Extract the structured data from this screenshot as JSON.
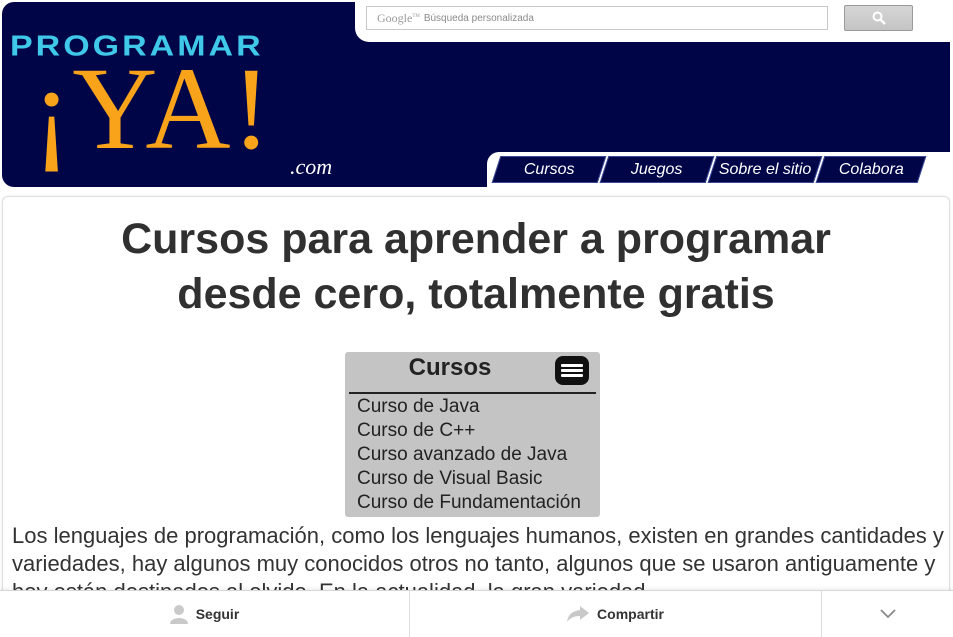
{
  "search": {
    "brand": "Google",
    "brand_tm": "TM",
    "placeholder": "Búsqueda personalizada",
    "button_icon": "search-icon"
  },
  "logo": {
    "top_text": "PROGRAMAR",
    "main_text": "¡YA!",
    "suffix": ".com"
  },
  "nav": {
    "items": [
      {
        "label": "Cursos"
      },
      {
        "label": "Juegos"
      },
      {
        "label": "Sobre el sitio"
      },
      {
        "label": "Colabora"
      }
    ]
  },
  "main": {
    "title_line1": "Cursos para aprender a programar",
    "title_line2": "desde cero, totalmente gratis",
    "courses_menu": {
      "title": "Cursos",
      "menu_icon": "hamburger-menu-icon",
      "items": [
        "Curso de Java",
        "Curso de C++",
        "Curso avanzado de Java",
        "Curso de Visual Basic",
        "Curso de Fundamentación"
      ]
    },
    "intro": "Los lenguajes de programación, como los lenguajes humanos, existen en grandes cantidades y variedades, hay algunos muy conocidos otros no tanto, algunos que se usaron antiguamente y hoy están destinados al olvido. En la actualidad, la gran variedad"
  },
  "share_bar": {
    "follow_label": "Seguir",
    "follow_icon": "person-icon",
    "share_label": "Compartir",
    "share_icon": "share-arrow-icon",
    "expand_icon": "chevron-down-icon"
  },
  "colors": {
    "header_bg": "#000548",
    "logo_cyan": "#3fc8e8",
    "logo_orange": "#f9a31a",
    "menu_bg": "#c4c4c4"
  }
}
